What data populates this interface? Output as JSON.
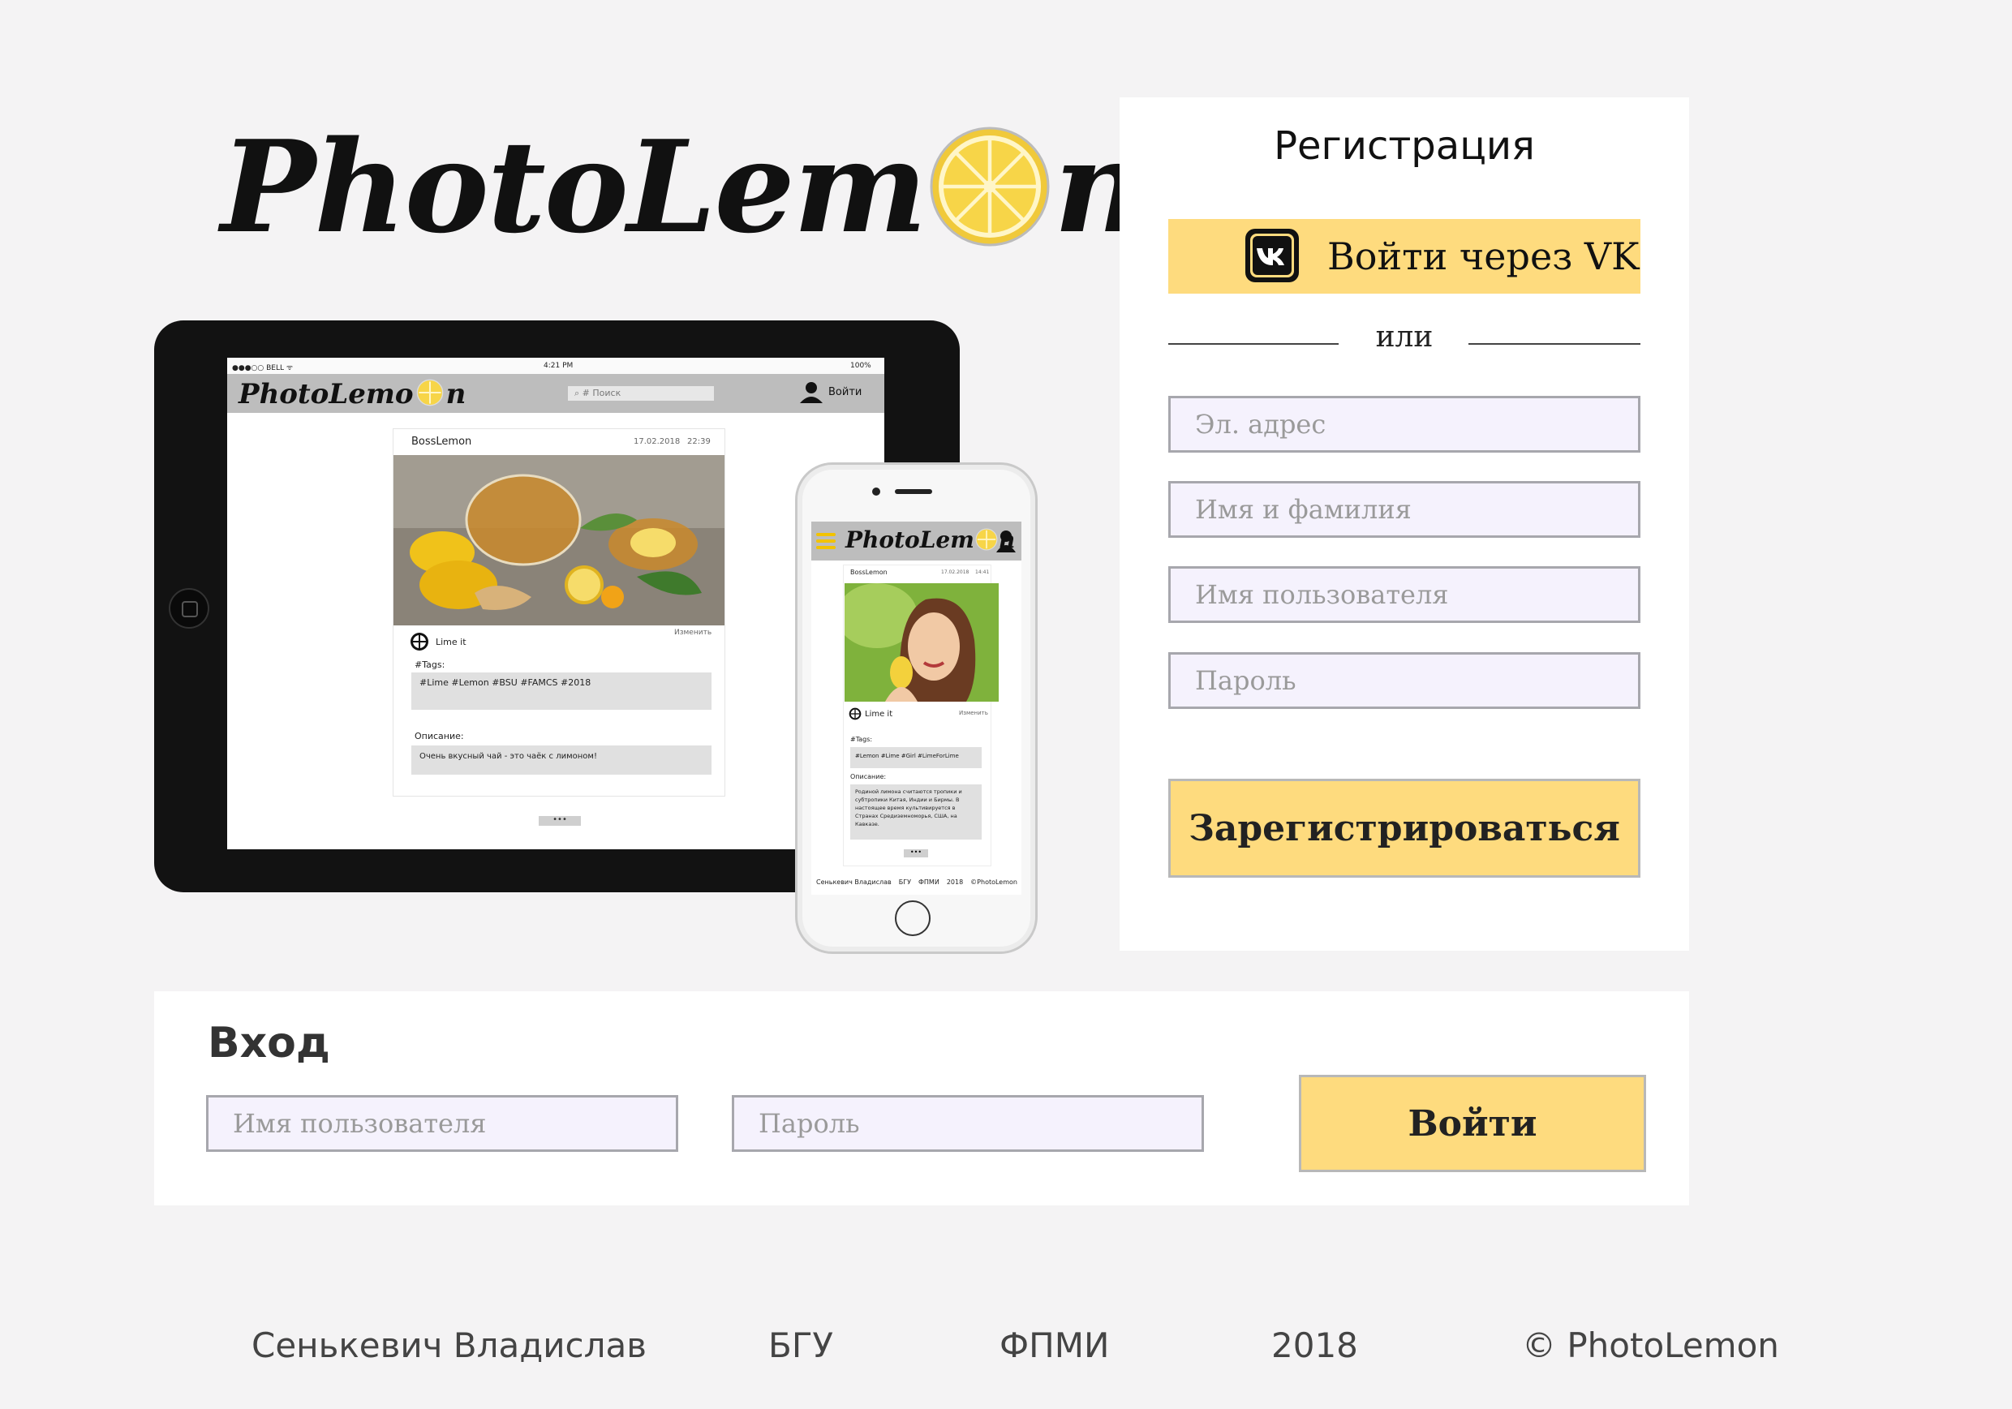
{
  "brand": {
    "logo_left": "PhotoLem",
    "logo_right": "n"
  },
  "mockup": {
    "tablet": {
      "status_carrier": "●●●○○ BELL ᯤ",
      "status_time": "4:21 PM",
      "status_battery": "100%",
      "search_placeholder": "# Поиск",
      "login_label": "Войти",
      "post_author": "BossLemon",
      "post_date": "17.02.2018",
      "post_time": "22:39",
      "lime_label": "Lime it",
      "edit_label": "Изменить",
      "tags_label": "#Tags:",
      "tags": "#Lime #Lemon #BSU #FAMCS #2018",
      "description_label": "Описание:",
      "description": "Очень вкусный чай - это чаёк с лимоном!",
      "more_label": "•••"
    },
    "phone": {
      "post_author": "BossLemon",
      "post_date": "17.02.2018",
      "post_time": "14:41",
      "lime_label": "Lime it",
      "edit_label": "Изменить",
      "tags_label": "#Tags:",
      "tags": "#Lemon #Lime #Girl #LimeForLime",
      "description_label": "Описание:",
      "description": "Родиной лимона считаются тропики и субтропики Китая, Индии и Бирмы. В настоящее время культивируется в Странах Средиземноморья, США, на Кавказе.",
      "more_label": "•••",
      "footer": [
        "Сенькевич Владислав",
        "БГУ",
        "ФПМИ",
        "2018",
        "©PhotoLemon"
      ]
    }
  },
  "registration": {
    "title": "Регистрация",
    "vk_button": "Войти через VK",
    "or_text": "или",
    "email_placeholder": "Эл. адрес",
    "fullname_placeholder": "Имя и фамилия",
    "username_placeholder": "Имя пользователя",
    "password_placeholder": "Пароль",
    "submit": "Зарегистрироваться"
  },
  "login": {
    "title": "Вход",
    "username_placeholder": "Имя пользователя",
    "password_placeholder": "Пароль",
    "submit": "Войти"
  },
  "footer": {
    "author": "Сенькевич Владислав",
    "university": "БГУ",
    "faculty": "ФПМИ",
    "year": "2018",
    "copyright": "© PhotoLemon"
  },
  "colors": {
    "accent": "#fedb7e",
    "background": "#f4f3f4",
    "input_bg": "#f5f2fd",
    "lemon": "#f7d548"
  },
  "icons": [
    "lemon-logo-icon",
    "vk-icon",
    "user-icon",
    "search-icon",
    "lemon-like-icon",
    "menu-icon"
  ]
}
